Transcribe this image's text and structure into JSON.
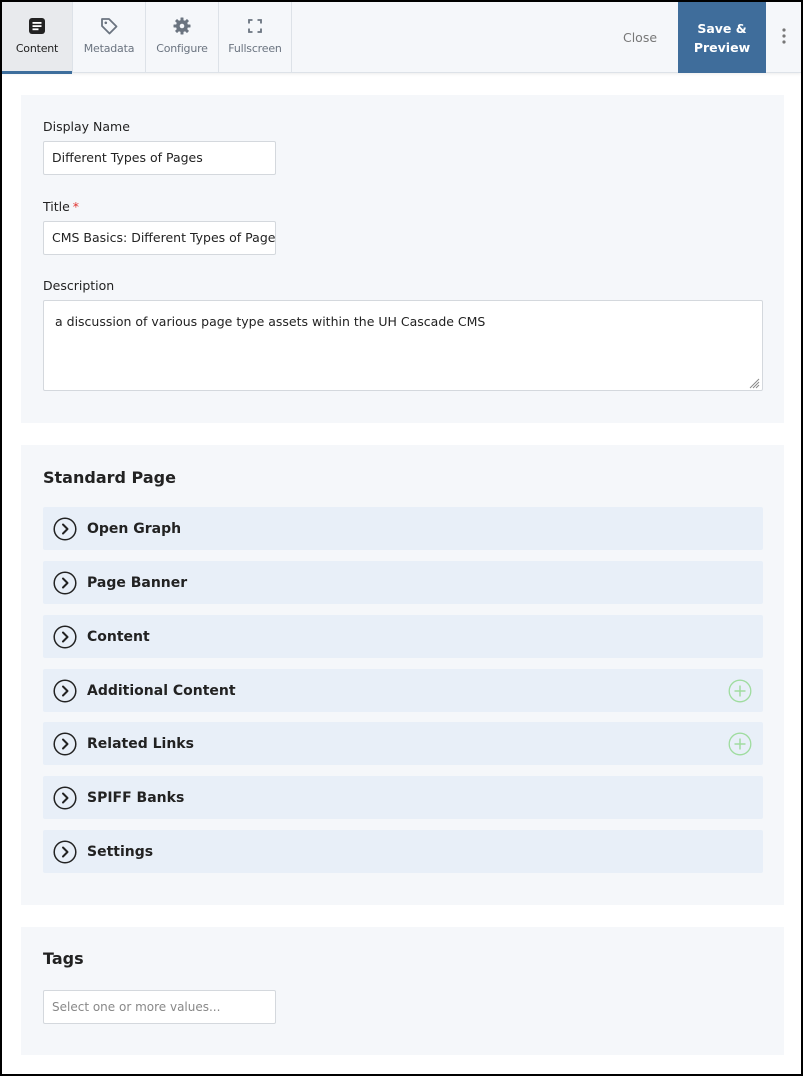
{
  "toolbar": {
    "tabs": [
      {
        "label": "Content",
        "icon": "document-icon",
        "active": true
      },
      {
        "label": "Metadata",
        "icon": "tag-icon",
        "active": false
      },
      {
        "label": "Configure",
        "icon": "gear-icon",
        "active": false
      },
      {
        "label": "Fullscreen",
        "icon": "fullscreen-icon",
        "active": false
      }
    ],
    "close_label": "Close",
    "save_label_line1": "Save &",
    "save_label_line2": "Preview",
    "more_icon": "vertical-ellipsis-icon",
    "accent_color": "#3f6d9b"
  },
  "form": {
    "display_name": {
      "label": "Display Name",
      "value": "Different Types of Pages"
    },
    "title": {
      "label": "Title",
      "required_marker": "*",
      "value": "CMS Basics: Different Types of Pages"
    },
    "description": {
      "label": "Description",
      "value": "a discussion of various page type assets within the UH Cascade CMS"
    }
  },
  "standard_page": {
    "title": "Standard Page",
    "sections": [
      {
        "label": "Open Graph",
        "addable": false
      },
      {
        "label": "Page Banner",
        "addable": false
      },
      {
        "label": "Content",
        "addable": false
      },
      {
        "label": "Additional Content",
        "addable": true
      },
      {
        "label": "Related Links",
        "addable": true
      },
      {
        "label": "SPIFF Banks",
        "addable": false
      },
      {
        "label": "Settings",
        "addable": false
      }
    ]
  },
  "tags": {
    "title": "Tags",
    "placeholder": "Select one or more values..."
  }
}
